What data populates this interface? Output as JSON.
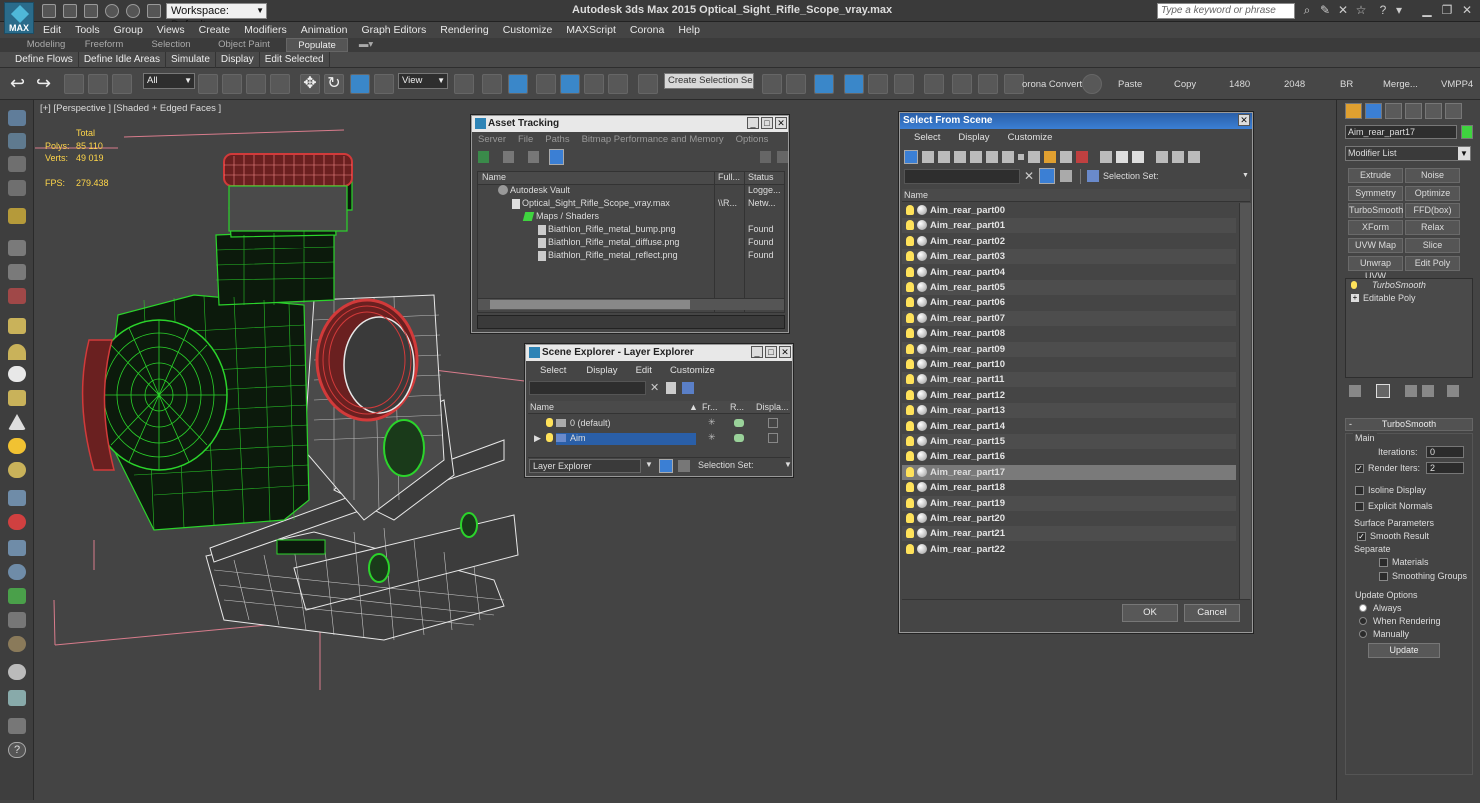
{
  "app": {
    "title": "Autodesk 3ds Max  2015    Optical_Sight_Rifle_Scope_vray.max",
    "logo_label": "MAX",
    "workspace": "Workspace: Default",
    "search_placeholder": "Type a keyword or phrase"
  },
  "menu": [
    "Edit",
    "Tools",
    "Group",
    "Views",
    "Create",
    "Modifiers",
    "Animation",
    "Graph Editors",
    "Rendering",
    "Customize",
    "MAXScript",
    "Corona",
    "Help"
  ],
  "ribbon_tabs": [
    "Modeling",
    "Freeform",
    "Selection",
    "Object Paint",
    "Populate"
  ],
  "ribbon_items": [
    "Define Flows",
    "Define Idle Areas",
    "Simulate",
    "Display",
    "Edit Selected"
  ],
  "toolbar": {
    "filter": "All",
    "refcoord": "View",
    "selection_set": "Create Selection Se",
    "corona_convert": "orona Convert",
    "paste": "Paste",
    "copy": "Copy",
    "res_w": "1480",
    "res_h": "2048",
    "br": "BR",
    "merge": "Merge...",
    "vmpp": "VMPP4"
  },
  "viewport": {
    "label": "[+] [Perspective ] [Shaded + Edged Faces ]",
    "stats_total": "Total",
    "stats_polys_label": "Polys:",
    "stats_polys": "85 110",
    "stats_verts_label": "Verts:",
    "stats_verts": "49 019",
    "stats_fps_label": "FPS:",
    "stats_fps": "279.438"
  },
  "asset_tracking": {
    "title": "Asset Tracking",
    "menu": [
      "Server",
      "File",
      "Paths",
      "Bitmap Performance and Memory",
      "Options"
    ],
    "columns": [
      "Name",
      "Full...",
      "Status"
    ],
    "rows": [
      {
        "name": "Autodesk Vault",
        "full": "",
        "status": "Logge..."
      },
      {
        "name": "Optical_Sight_Rifle_Scope_vray.max",
        "full": "\\\\R...",
        "status": "Netw..."
      },
      {
        "name": "Maps / Shaders",
        "full": "",
        "status": ""
      },
      {
        "name": "Biathlon_Rifle_metal_bump.png",
        "full": "",
        "status": "Found"
      },
      {
        "name": "Biathlon_Rifle_metal_diffuse.png",
        "full": "",
        "status": "Found"
      },
      {
        "name": "Biathlon_Rifle_metal_reflect.png",
        "full": "",
        "status": "Found"
      }
    ]
  },
  "scene_explorer": {
    "title": "Scene Explorer - Layer Explorer",
    "menu": [
      "Select",
      "Display",
      "Edit",
      "Customize"
    ],
    "columns": [
      "Name",
      "Fr...",
      "R...",
      "Displa..."
    ],
    "rows": [
      {
        "name": "0 (default)"
      },
      {
        "name": "Aim"
      }
    ],
    "footer_dropdown": "Layer Explorer",
    "footer_selset": "Selection Set:"
  },
  "select_from_scene": {
    "title": "Select From Scene",
    "menu": [
      "Select",
      "Display",
      "Customize"
    ],
    "selection_set_label": "Selection Set:",
    "column_name": "Name",
    "items": [
      "Aim_rear_part00",
      "Aim_rear_part01",
      "Aim_rear_part02",
      "Aim_rear_part03",
      "Aim_rear_part04",
      "Aim_rear_part05",
      "Aim_rear_part06",
      "Aim_rear_part07",
      "Aim_rear_part08",
      "Aim_rear_part09",
      "Aim_rear_part10",
      "Aim_rear_part11",
      "Aim_rear_part12",
      "Aim_rear_part13",
      "Aim_rear_part14",
      "Aim_rear_part15",
      "Aim_rear_part16",
      "Aim_rear_part17",
      "Aim_rear_part18",
      "Aim_rear_part19",
      "Aim_rear_part20",
      "Aim_rear_part21",
      "Aim_rear_part22"
    ],
    "selected_item": "Aim_rear_part17",
    "ok": "OK",
    "cancel": "Cancel"
  },
  "command_panel": {
    "object_name": "Aim_rear_part17",
    "object_color": "#3fd43f",
    "modifier_list": "Modifier List",
    "modifier_buttons": [
      "Extrude",
      "Noise",
      "Symmetry",
      "Optimize",
      "TurboSmooth",
      "FFD(box)",
      "XForm",
      "Relax",
      "UVW Map",
      "Slice",
      "Unwrap UVW",
      "Edit Poly"
    ],
    "stack": [
      "TurboSmooth",
      "Editable Poly"
    ],
    "rollout_title": "TurboSmooth",
    "main_label": "Main",
    "iterations_label": "Iterations:",
    "iterations": "0",
    "render_iters_label": "Render Iters:",
    "render_iters": "2",
    "isoline_display": "Isoline Display",
    "explicit_normals": "Explicit Normals",
    "surface_params": "Surface Parameters",
    "smooth_result": "Smooth Result",
    "separate": "Separate",
    "materials": "Materials",
    "smoothing_groups": "Smoothing Groups",
    "update_options": "Update Options",
    "always": "Always",
    "when_rendering": "When Rendering",
    "manually": "Manually",
    "update_button": "Update"
  },
  "colors": {
    "wire_green": "#2bd42b",
    "wire_red": "#c83232",
    "wire_white": "#e8e8e8",
    "selection_blue": "#2a5fa8"
  }
}
